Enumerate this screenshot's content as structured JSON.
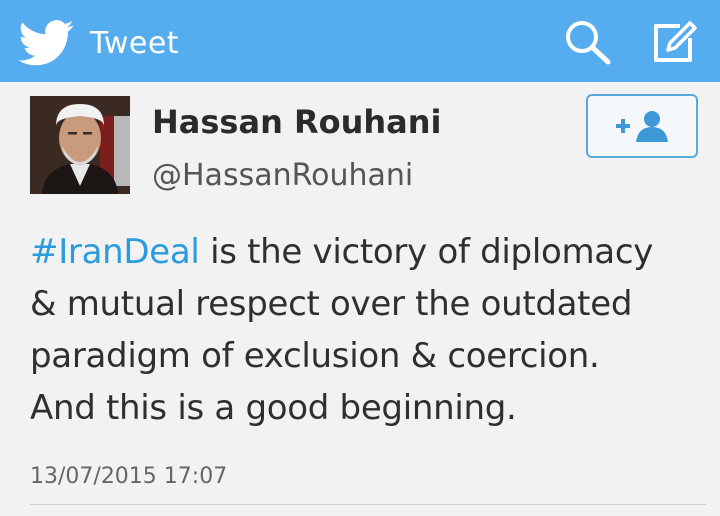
{
  "header": {
    "title": "Tweet",
    "bar_color": "#55acee",
    "logo_icon": "twitter-bird-icon",
    "search_icon": "search-icon",
    "compose_icon": "compose-icon"
  },
  "tweet": {
    "author_name": "Hassan Rouhani",
    "author_handle": "@HassanRouhani",
    "follow_icon": "add-user-icon",
    "hashtag": "#IranDeal",
    "body_line1_rest": " is the victory of diplomacy",
    "body_line2": "& mutual respect over the outdated",
    "body_line3": "paradigm of exclusion & coercion.",
    "body_line4": "And this is a good beginning.",
    "timestamp": "13/07/2015 17:07",
    "hashtag_color": "#2a9bdc"
  }
}
